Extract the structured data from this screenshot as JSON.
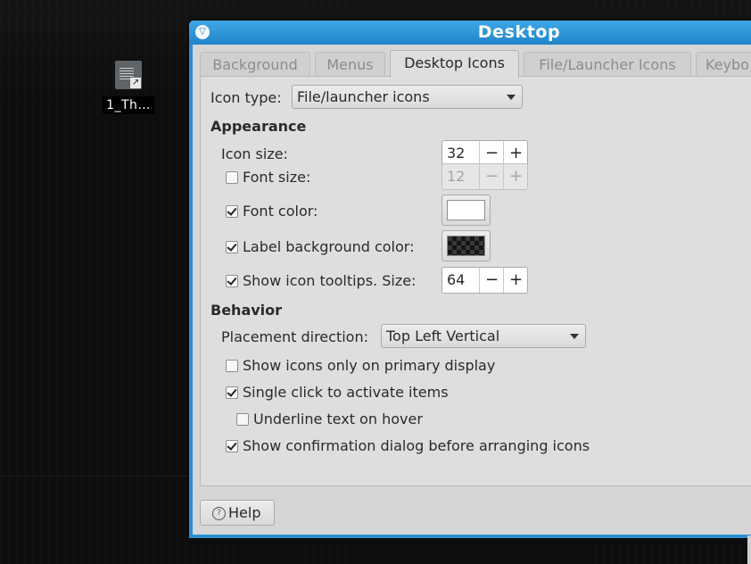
{
  "desktop": {
    "icon_label": "1_Th…"
  },
  "window": {
    "title": "Desktop",
    "tabs": [
      {
        "label": "Background",
        "active": false
      },
      {
        "label": "Menus",
        "active": false
      },
      {
        "label": "Desktop Icons",
        "active": true
      },
      {
        "label": "File/Launcher Icons",
        "active": false
      },
      {
        "label": "Keybo",
        "active": false
      }
    ],
    "icon_type_label": "Icon type:",
    "icon_type_value": "File/launcher icons",
    "appearance": {
      "heading": "Appearance",
      "icon_size_label": "Icon size:",
      "icon_size_value": "32",
      "font_size_label": "Font size:",
      "font_size_checked": false,
      "font_size_value": "12",
      "font_color_label": "Font color:",
      "font_color_checked": true,
      "font_color": "#ffffff",
      "label_bg_label": "Label background color:",
      "label_bg_checked": true,
      "tooltips_label": "Show icon tooltips. Size:",
      "tooltips_checked": true,
      "tooltips_size_value": "64"
    },
    "behavior": {
      "heading": "Behavior",
      "placement_label": "Placement direction:",
      "placement_value": "Top Left Vertical",
      "primary_display_label": "Show icons only on primary display",
      "primary_display_checked": false,
      "single_click_label": "Single click to activate items",
      "single_click_checked": true,
      "underline_label": "Underline text on hover",
      "underline_checked": false,
      "confirm_label": "Show confirmation dialog before arranging icons",
      "confirm_checked": true
    },
    "help_label": "Help",
    "spin_minus": "−",
    "spin_plus": "+"
  },
  "colors": {
    "titlebar": "#2a8fcf",
    "dialog_bg": "#d6d6d6"
  }
}
